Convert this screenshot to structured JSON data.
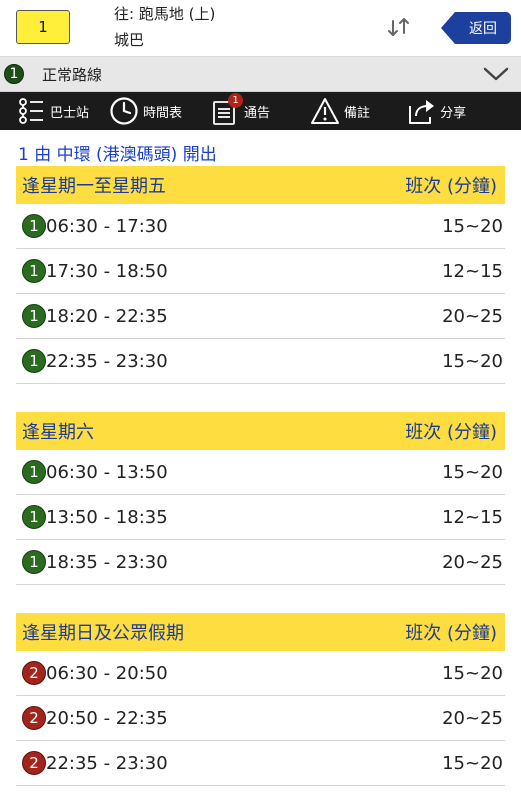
{
  "header": {
    "route_number": "1",
    "destination": "往: 跑馬地 (上)",
    "company": "城巴",
    "back_label": "返回"
  },
  "variant": {
    "badge": "1",
    "label": "正常路線"
  },
  "toolbar": {
    "stops_label": "巴士站",
    "timetable_label": "時間表",
    "notice_label": "通告",
    "notice_count": "1",
    "remarks_label": "備註",
    "share_label": "分享"
  },
  "departure": "1 由 中環 (港澳碼頭) 開出",
  "sections": [
    {
      "title": "逢星期一至星期五",
      "freq_header": "班次 (分鐘)",
      "rows": [
        {
          "badge": "1",
          "time": "06:30 - 17:30",
          "freq": "15~20"
        },
        {
          "badge": "1",
          "time": "17:30 - 18:50",
          "freq": "12~15"
        },
        {
          "badge": "1",
          "time": "18:20 - 22:35",
          "freq": "20~25"
        },
        {
          "badge": "1",
          "time": "22:35 - 23:30",
          "freq": "15~20"
        }
      ]
    },
    {
      "title": "逢星期六",
      "freq_header": "班次 (分鐘)",
      "rows": [
        {
          "badge": "1",
          "time": "06:30 - 13:50",
          "freq": "15~20"
        },
        {
          "badge": "1",
          "time": "13:50 - 18:35",
          "freq": "12~15"
        },
        {
          "badge": "1",
          "time": "18:35 - 23:30",
          "freq": "20~25"
        }
      ]
    },
    {
      "title": "逢星期日及公眾假期",
      "freq_header": "班次 (分鐘)",
      "rows": [
        {
          "badge": "2",
          "time": "06:30 - 20:50",
          "freq": "15~20"
        },
        {
          "badge": "2",
          "time": "20:50 - 22:35",
          "freq": "20~25"
        },
        {
          "badge": "2",
          "time": "22:35 - 23:30",
          "freq": "15~20"
        }
      ]
    }
  ],
  "colors": {
    "route_badge": "#ffef3a",
    "back_button": "#1d3f9e",
    "section_header_bg": "#fddd3f",
    "section_header_text": "#1e3b93",
    "variant_1": "#2a6b1f",
    "variant_2": "#a3241c",
    "departure_text": "#1a3fd0"
  },
  "icons": [
    "swap-arrows-icon",
    "chevron-down-icon",
    "bus-stops-icon",
    "clock-icon",
    "notice-icon",
    "warning-icon",
    "share-icon"
  ]
}
